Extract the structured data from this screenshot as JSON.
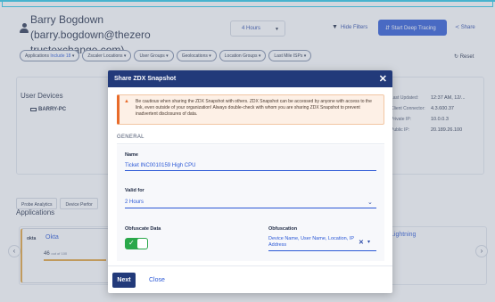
{
  "header": {
    "user_name_line1": "Barry Bogdown (barry.bogdown@thezero",
    "user_name_line2": "trustexchange.com)",
    "time_range": "4 Hours",
    "hide_filters": "Hide Filters",
    "deep_tracing": "Start Deep Tracing",
    "share": "Share"
  },
  "filters": {
    "applications_label": "Applications",
    "applications_include": "Include 18",
    "items": [
      "Zscaler Locations",
      "User Groups",
      "Geolocations",
      "Location Groups",
      "Last Mile ISPs"
    ],
    "reset": "Reset"
  },
  "devices": {
    "title": "User Devices",
    "device_name": "BARRY-PC",
    "details": [
      {
        "key": "Last Updated:",
        "value": "12:37 AM, 12/..."
      },
      {
        "key": "Client Connector:",
        "value": "4.3.600.37"
      },
      {
        "key": "Private IP:",
        "value": "10.0.0.3"
      },
      {
        "key": "Public IP:",
        "value": "20.189.26.100"
      }
    ]
  },
  "tabs": [
    "Probe Analytics",
    "Device Perfor"
  ],
  "applications": {
    "title": "Applications",
    "okta_logo": "okta",
    "okta_name": "Okta",
    "okta_score": "46",
    "okta_score_suffix": "out of 100",
    "other_app": "Lightning"
  },
  "modal": {
    "title": "Share ZDX Snapshot",
    "warning": "Be cautious when sharing the ZDX Snapshot with others. ZDX Snapshot can be accessed by anyone with access to the link, even outside of your organization! Always double-check with whom you are sharing ZDX Snapshot to prevent inadvertent disclosures of data.",
    "section": "GENERAL",
    "name_label": "Name",
    "name_value": "Ticket INC0010159 High CPU",
    "valid_label": "Valid for",
    "valid_value": "2 Hours",
    "obfuscate_label": "Obfuscate Data",
    "obfuscation_label": "Obfuscation",
    "obfuscation_value": "Device Name, User Name, Location, IP Address",
    "next": "Next",
    "close": "Close"
  },
  "colors": {
    "header": "#223a7a",
    "primary": "#2b58d6",
    "toggle_on": "#2aa84a",
    "warning_accent": "#e86b2a"
  }
}
